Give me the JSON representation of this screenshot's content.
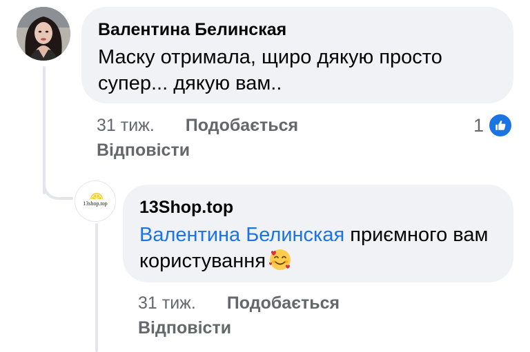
{
  "comment": {
    "author": "Валентина Белинская",
    "text": "Маску отримала, щиро дякую просто супер... дякую вам..",
    "time": "31 тиж.",
    "like_label": "Подобається",
    "reply_label": "Відповісти",
    "reaction_count": "1",
    "reaction_icon": "like-icon"
  },
  "reply": {
    "author": "13Shop.top",
    "avatar_text": "13shop.top",
    "mention": "Валентина Белинская",
    "text_after_mention": " приємного вам користування",
    "emoji": "smiling-face-with-hearts-icon",
    "time": "31 тиж.",
    "like_label": "Подобається",
    "reply_label": "Відповісти"
  },
  "colors": {
    "bubble_bg": "#f0f2f5",
    "text": "#050505",
    "meta": "#65676b",
    "mention": "#1b74e4",
    "like_badge": "#1b74e4"
  }
}
